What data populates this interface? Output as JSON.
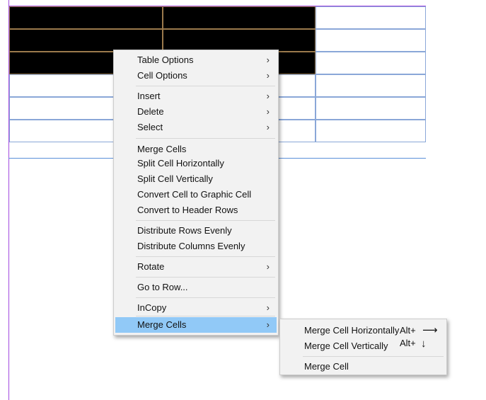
{
  "context_menu": {
    "items": [
      {
        "label": "Table Options",
        "submenu": true
      },
      {
        "label": "Cell Options",
        "submenu": true
      },
      {
        "label": "Insert",
        "submenu": true
      },
      {
        "label": "Delete",
        "submenu": true
      },
      {
        "label": "Select",
        "submenu": true
      },
      {
        "label": "Merge Cells",
        "submenu": false
      },
      {
        "label": "Split Cell Horizontally",
        "submenu": false
      },
      {
        "label": "Split Cell Vertically",
        "submenu": false
      },
      {
        "label": "Convert Cell to Graphic Cell",
        "submenu": false
      },
      {
        "label": "Convert to Header Rows",
        "submenu": false
      },
      {
        "label": "Distribute Rows Evenly",
        "submenu": false
      },
      {
        "label": "Distribute Columns Evenly",
        "submenu": false
      },
      {
        "label": "Rotate",
        "submenu": true
      },
      {
        "label": "Go to Row...",
        "submenu": false
      },
      {
        "label": "InCopy",
        "submenu": true
      },
      {
        "label": "Merge Cells",
        "submenu": true,
        "active": true
      }
    ],
    "chevron": "›"
  },
  "submenu": {
    "items": [
      {
        "label": "Merge Cell Horizontally",
        "shortcut": "Alt+",
        "arrow": "⟶"
      },
      {
        "label": "Merge Cell Vertically",
        "shortcut": "Alt+",
        "arrow": "↓"
      },
      {
        "label": "Merge Cell"
      }
    ]
  },
  "colors": {
    "selected_cell": "#000000",
    "menu_highlight": "#91c9f7",
    "guide": "#a24be0",
    "table_border": "#8aa7d8"
  }
}
